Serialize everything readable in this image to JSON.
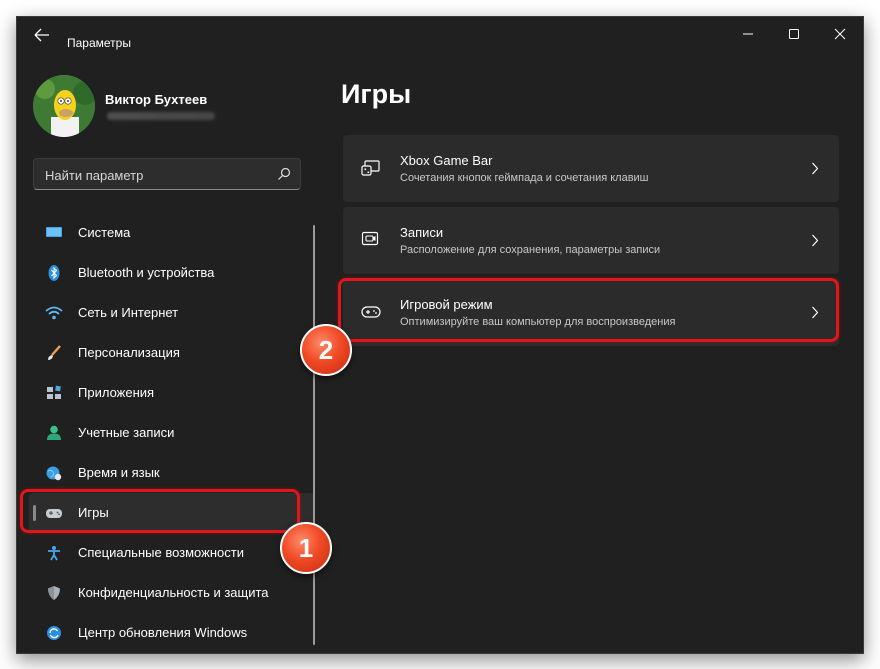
{
  "window": {
    "title": "Параметры",
    "controls": [
      "minimize-icon",
      "maximize-icon",
      "close-icon"
    ]
  },
  "profile": {
    "name": "Виктор Бухтеев"
  },
  "search": {
    "placeholder": "Найти параметр"
  },
  "sidebar": {
    "items": [
      {
        "label": "Система",
        "icon": "system-icon"
      },
      {
        "label": "Bluetooth и устройства",
        "icon": "bluetooth-icon"
      },
      {
        "label": "Сеть и Интернет",
        "icon": "wifi-icon"
      },
      {
        "label": "Персонализация",
        "icon": "brush-icon"
      },
      {
        "label": "Приложения",
        "icon": "apps-icon"
      },
      {
        "label": "Учетные записи",
        "icon": "account-icon"
      },
      {
        "label": "Время и язык",
        "icon": "globe-icon"
      },
      {
        "label": "Игры",
        "icon": "gamepad-icon",
        "selected": true
      },
      {
        "label": "Специальные возможности",
        "icon": "accessibility-icon"
      },
      {
        "label": "Конфиденциальность и защита",
        "icon": "shield-icon"
      },
      {
        "label": "Центр обновления Windows",
        "icon": "update-icon"
      }
    ]
  },
  "main": {
    "title": "Игры",
    "cards": [
      {
        "title": "Xbox Game Bar",
        "subtitle": "Сочетания кнопок геймпада и сочетания клавиш",
        "icon": "game-bar-icon"
      },
      {
        "title": "Записи",
        "subtitle": "Расположение для сохранения, параметры записи",
        "icon": "capture-icon"
      },
      {
        "title": "Игровой режим",
        "subtitle": "Оптимизируйте ваш компьютер для воспроизведения",
        "icon": "game-mode-icon"
      }
    ]
  },
  "annotations": {
    "marker_1": "1",
    "marker_2": "2",
    "color": "#e0161b"
  },
  "colors": {
    "window_bg": "#202020",
    "card_bg": "#2b2b2b",
    "selected_bg": "#2d2d2d"
  }
}
